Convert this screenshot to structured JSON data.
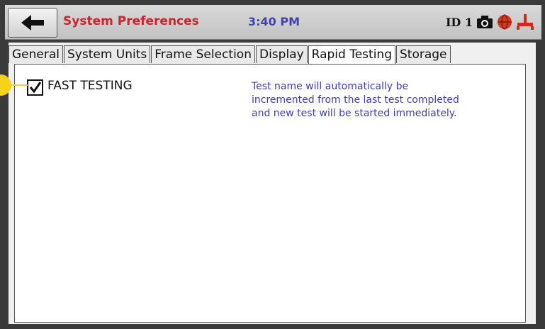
{
  "header": {
    "title": "System Preferences",
    "time": "3:40 PM",
    "id_label": "ID 1",
    "icons": [
      "back-arrow-icon",
      "camera-icon",
      "globe-icon",
      "usb-icon"
    ]
  },
  "tabs": [
    {
      "label": "General",
      "active": false
    },
    {
      "label": "System Units",
      "active": false
    },
    {
      "label": "Frame Selection",
      "active": false
    },
    {
      "label": "Display",
      "active": false
    },
    {
      "label": "Rapid Testing",
      "active": true
    },
    {
      "label": "Storage",
      "active": false
    }
  ],
  "rapid_testing": {
    "fast_testing_label": "FAST TESTING",
    "fast_testing_checked": true,
    "description": "Test name will automatically be incremented from the last test completed and new test will be started immediately."
  },
  "colors": {
    "title": "#c8252e",
    "time": "#3f45b0",
    "description": "#3e3eb4",
    "callout": "#f7d21a",
    "globe": "#d03a1c",
    "usb": "#d12a1f"
  }
}
